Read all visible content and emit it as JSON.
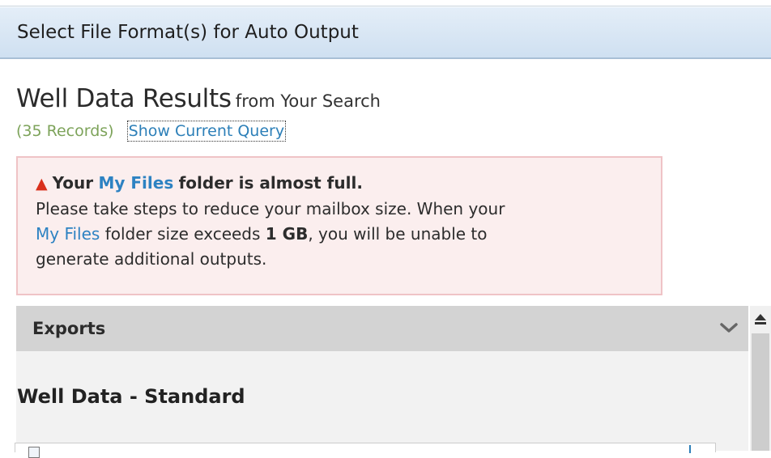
{
  "window": {
    "title": "Select File Format(s) for Auto Output"
  },
  "results": {
    "heading": "Well Data Results",
    "heading_suffix": "from Your Search",
    "records": "(35 Records)",
    "show_query_link": "Show Current Query"
  },
  "warning": {
    "icon": "warning-triangle-icon",
    "title_prefix": "Your",
    "title_link": "My Files",
    "title_suffix": "folder is almost full.",
    "body_1": "Please take steps to reduce your mailbox size. When your",
    "body_link": "My Files",
    "body_2": "folder size exceeds",
    "body_limit": "1 GB",
    "body_3": ", you will be unable to",
    "body_4": "generate additional outputs."
  },
  "exports": {
    "header": "Exports",
    "chevron_icon": "chevron-down-icon",
    "section_title": "Well Data - Standard"
  },
  "colors": {
    "title_bar": "#d5e4f3",
    "records_green": "#7da35a",
    "link_blue": "#2c7fb8",
    "warning_bg": "#fbeeee",
    "warning_border": "#efc3c6",
    "warning_icon": "#d9301c",
    "panel_header": "#d3d3d3",
    "panel_bg": "#f2f2f2"
  }
}
